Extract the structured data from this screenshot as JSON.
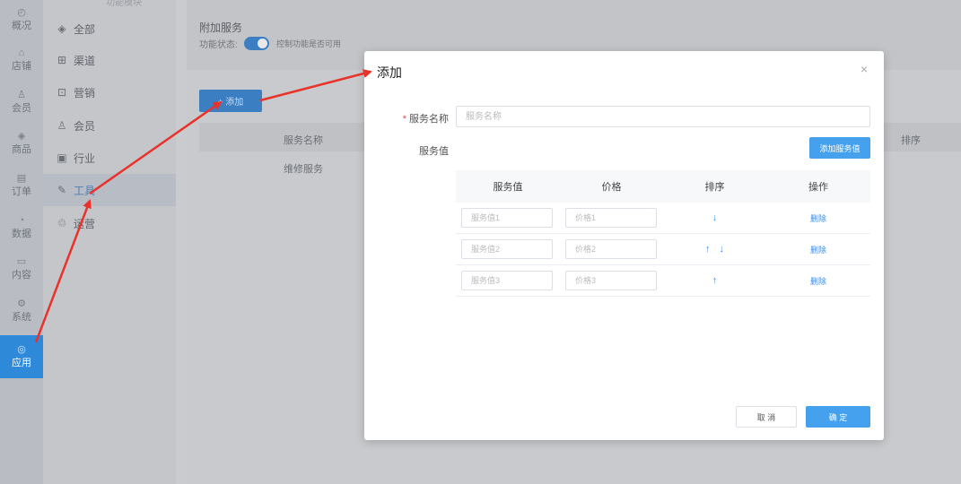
{
  "rail": {
    "items": [
      {
        "icon": "dashboard-icon",
        "glyph": "◴",
        "label": "概况"
      },
      {
        "icon": "store-icon",
        "glyph": "⌂",
        "label": "店铺"
      },
      {
        "icon": "member-icon",
        "glyph": "♙",
        "label": "会员"
      },
      {
        "icon": "goods-icon",
        "glyph": "◈",
        "label": "商品"
      },
      {
        "icon": "order-icon",
        "glyph": "▤",
        "label": "订单"
      },
      {
        "icon": "data-icon",
        "glyph": "◔",
        "label": "数据"
      },
      {
        "icon": "content-icon",
        "glyph": "▭",
        "label": "内容"
      },
      {
        "icon": "system-icon",
        "glyph": "⚙",
        "label": "系统"
      },
      {
        "icon": "app-icon",
        "glyph": "◎",
        "label": "应用"
      }
    ]
  },
  "menu2": {
    "top_text": "功能模块",
    "items": [
      {
        "glyph": "◈",
        "label": "全部"
      },
      {
        "glyph": "⊞",
        "label": "渠道"
      },
      {
        "glyph": "⊡",
        "label": "营销"
      },
      {
        "glyph": "♙",
        "label": "会员"
      },
      {
        "glyph": "▣",
        "label": "行业"
      },
      {
        "glyph": "✎",
        "label": "工具"
      },
      {
        "glyph": "♲",
        "label": "运营"
      }
    ]
  },
  "page": {
    "section_title": "附加服务",
    "status_label": "功能状态:",
    "status_desc": "控制功能是否可用",
    "add_button": "+ 添加",
    "table": {
      "col_name": "服务名称",
      "col_sort": "排序",
      "rows": [
        "维修服务"
      ]
    }
  },
  "modal": {
    "title": "添加",
    "close_glyph": "×",
    "name_label": "服务名称",
    "required_mark": "*",
    "name_placeholder": "服务名称",
    "values_label": "服务值",
    "add_value_button": "添加服务值",
    "table_headers": {
      "value": "服务值",
      "price": "价格",
      "sort": "排序",
      "action": "操作"
    },
    "rows": [
      {
        "value_placeholder": "服务值1",
        "price_placeholder": "价格1",
        "up": "",
        "down": "↓",
        "delete": "删除"
      },
      {
        "value_placeholder": "服务值2",
        "price_placeholder": "价格2",
        "up": "↑",
        "down": "↓",
        "delete": "删除"
      },
      {
        "value_placeholder": "服务值3",
        "price_placeholder": "价格3",
        "up": "↑",
        "down": "",
        "delete": "删除"
      }
    ],
    "cancel_button": "取 消",
    "ok_button": "确 定"
  },
  "colors": {
    "accent": "#45a0ee",
    "annotation": "#e8322a",
    "required": "#e5474b"
  }
}
